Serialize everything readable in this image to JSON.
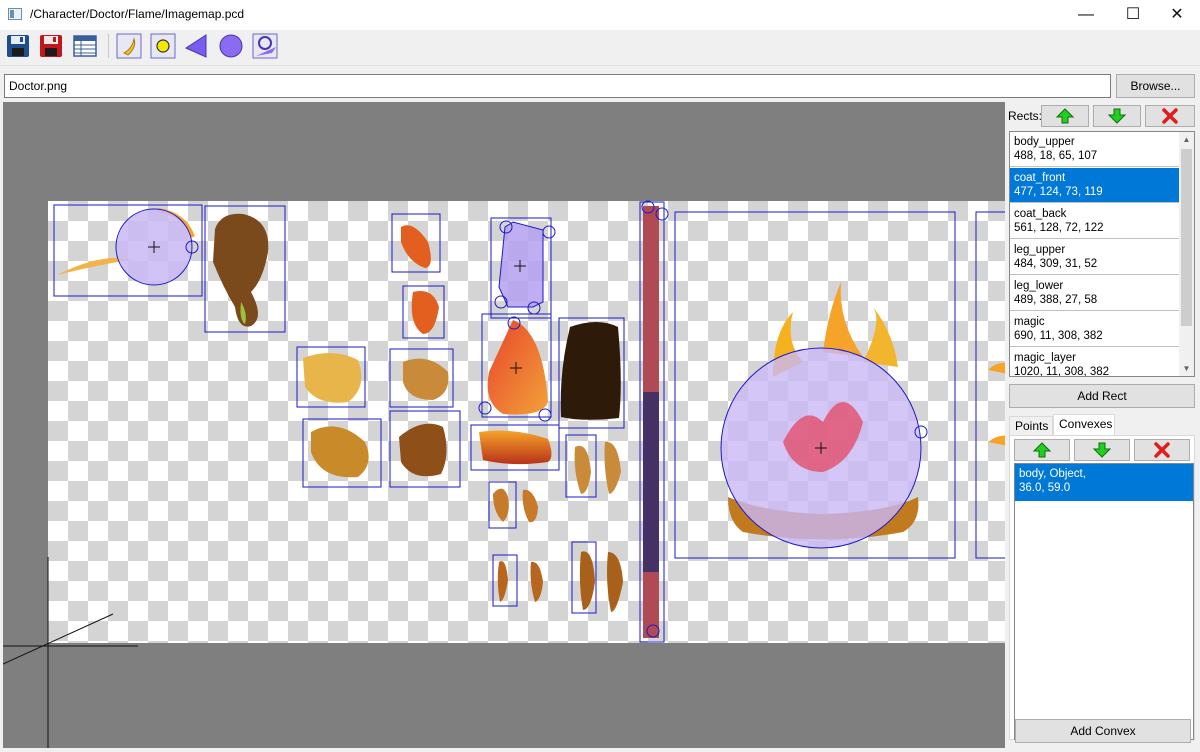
{
  "window": {
    "title": "/Character/Doctor/Flame/Imagemap.pcd",
    "minimize_glyph": "—",
    "maximize_glyph": "☐",
    "close_glyph": "✕"
  },
  "toolbar": {
    "tools": [
      {
        "name": "save-icon",
        "color": "#1f4e8c"
      },
      {
        "name": "save-as-icon",
        "color": "#c0161e"
      },
      {
        "name": "table-icon",
        "color": "#3a5f9a"
      },
      {
        "name": "add-image-icon",
        "color": "#f2c12e"
      },
      {
        "name": "add-point-icon",
        "color": "#f5e800"
      },
      {
        "name": "add-triangle-icon",
        "color": "#7b5cf0"
      },
      {
        "name": "add-circle-icon",
        "color": "#8a6cf2"
      },
      {
        "name": "add-convex-icon",
        "color": "#8a6cf2"
      }
    ]
  },
  "file": {
    "value": "Doctor.png",
    "browse_label": "Browse..."
  },
  "canvas": {
    "background_color": "#7f7f7f",
    "outline_color": "#1a1acc"
  },
  "rects": {
    "label": "Rects:",
    "items": [
      {
        "name": "body_upper",
        "values": "488, 18, 65, 107"
      },
      {
        "name": "coat_front",
        "values": "477, 124, 73, 119"
      },
      {
        "name": "coat_back",
        "values": "561, 128, 72, 122"
      },
      {
        "name": "leg_upper",
        "values": "484, 309, 31, 52"
      },
      {
        "name": "leg_lower",
        "values": "489, 388, 27, 58"
      },
      {
        "name": "magic",
        "values": "690, 11, 308, 382"
      },
      {
        "name": "magic_layer",
        "values": "1020, 11, 308, 382"
      }
    ],
    "selected_index": 1,
    "add_label": "Add Rect"
  },
  "tabs": [
    {
      "label": "Points"
    },
    {
      "label": "Convexes"
    }
  ],
  "convexes": {
    "items": [
      {
        "line1": "body, Object,",
        "line2": "36.0, 59.0"
      }
    ],
    "add_label": "Add Convex"
  },
  "colors": {
    "selection": "#0078d7",
    "up_arrow": "#1fd11f",
    "down_arrow": "#1fd11f",
    "delete": "#e21b1b"
  }
}
